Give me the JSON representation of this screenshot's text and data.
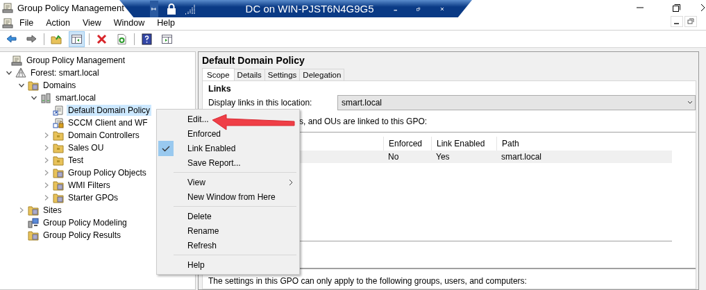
{
  "window": {
    "title": "Group Policy Management"
  },
  "remote_bar": {
    "title": "DC on WIN-PJST6N4G9G5"
  },
  "menu_bar": [
    "File",
    "Action",
    "View",
    "Window",
    "Help"
  ],
  "toolbar": [
    {
      "kind": "back",
      "pressed": false
    },
    {
      "kind": "forward",
      "pressed": false
    },
    {
      "kind": "sep"
    },
    {
      "kind": "up",
      "pressed": false
    },
    {
      "kind": "tree",
      "pressed": true
    },
    {
      "kind": "sep"
    },
    {
      "kind": "delete",
      "pressed": false
    },
    {
      "kind": "refresh",
      "pressed": false
    },
    {
      "kind": "sep"
    },
    {
      "kind": "help",
      "pressed": false
    },
    {
      "kind": "action",
      "pressed": false
    }
  ],
  "tree": [
    {
      "label": "Group Policy Management",
      "kind": "console",
      "selected": false,
      "children": [
        {
          "label": "Forest: smart.local",
          "kind": "forest",
          "expanded": true,
          "selected": false,
          "children": [
            {
              "label": "Domains",
              "kind": "folder",
              "expanded": true,
              "selected": false,
              "children": [
                {
                  "label": "smart.local",
                  "kind": "domain",
                  "expanded": true,
                  "selected": false,
                  "children": [
                    {
                      "label": "Default Domain Policy",
                      "kind": "gpo-link",
                      "selected": true
                    },
                    {
                      "label": "SCCM Client and WF",
                      "kind": "gpo-locked",
                      "selected": false
                    },
                    {
                      "label": "Domain Controllers",
                      "kind": "ou",
                      "expanded": false,
                      "selected": false
                    },
                    {
                      "label": "Sales OU",
                      "kind": "ou",
                      "expanded": false,
                      "selected": false
                    },
                    {
                      "label": "Test",
                      "kind": "ou",
                      "expanded": false,
                      "selected": false
                    },
                    {
                      "label": "Group Policy Objects",
                      "kind": "folder",
                      "expanded": false,
                      "selected": false
                    },
                    {
                      "label": "WMI Filters",
                      "kind": "folder",
                      "expanded": false,
                      "selected": false
                    },
                    {
                      "label": "Starter GPOs",
                      "kind": "folder",
                      "expanded": false,
                      "selected": false
                    }
                  ]
                }
              ]
            },
            {
              "label": "Sites",
              "kind": "folder",
              "expanded": false,
              "selected": false
            },
            {
              "label": "Group Policy Modeling",
              "kind": "modeling",
              "selected": false
            },
            {
              "label": "Group Policy Results",
              "kind": "folder",
              "selected": false
            }
          ]
        }
      ]
    }
  ],
  "details": {
    "title": "Default Domain Policy",
    "tabs": [
      {
        "label": "Scope",
        "selected": true
      },
      {
        "label": "Details",
        "selected": false
      },
      {
        "label": "Settings",
        "selected": false
      },
      {
        "label": "Delegation",
        "selected": false
      }
    ],
    "links_heading": "Links",
    "location_label": "Display links in this location:",
    "location_value": "smart.local",
    "links_note": "s, and OUs are linked to this GPO:",
    "table": {
      "columns": [
        "Enforced",
        "Link Enabled",
        "Path"
      ],
      "rows": [
        [
          "No",
          "Yes",
          "smart.local"
        ]
      ]
    },
    "filter_note": "The settings in this GPO can only apply to the following groups, users, and computers:"
  },
  "context_menu": [
    {
      "kind": "item",
      "label": "Edit...",
      "checked": false
    },
    {
      "kind": "item",
      "label": "Enforced",
      "checked": false
    },
    {
      "kind": "item",
      "label": "Link Enabled",
      "checked": true
    },
    {
      "kind": "item",
      "label": "Save Report...",
      "checked": false
    },
    {
      "kind": "separator"
    },
    {
      "kind": "submenu",
      "label": "View",
      "checked": false
    },
    {
      "kind": "item",
      "label": "New Window from Here",
      "checked": false
    },
    {
      "kind": "separator"
    },
    {
      "kind": "item",
      "label": "Delete",
      "checked": false
    },
    {
      "kind": "item",
      "label": "Rename",
      "checked": false
    },
    {
      "kind": "item",
      "label": "Refresh",
      "checked": false
    },
    {
      "kind": "separator"
    },
    {
      "kind": "item",
      "label": "Help",
      "checked": false
    }
  ]
}
